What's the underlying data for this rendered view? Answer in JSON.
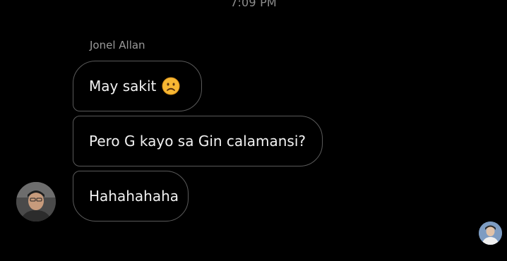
{
  "conversation": {
    "timestamp": "7:09 PM",
    "sender_name": "Jonel Allan",
    "messages": [
      {
        "text": "May sakit",
        "emoji": "frowning-face-icon"
      },
      {
        "text": "Pero G kayo sa Gin calamansi?"
      },
      {
        "text": "Hahahahaha"
      }
    ]
  },
  "colors": {
    "background": "#000000",
    "bubble_border": "#5a5a5a",
    "bubble_text": "#f2f2f2",
    "meta_text": "#9a9a9a",
    "emoji_fill": "#f7b733"
  }
}
